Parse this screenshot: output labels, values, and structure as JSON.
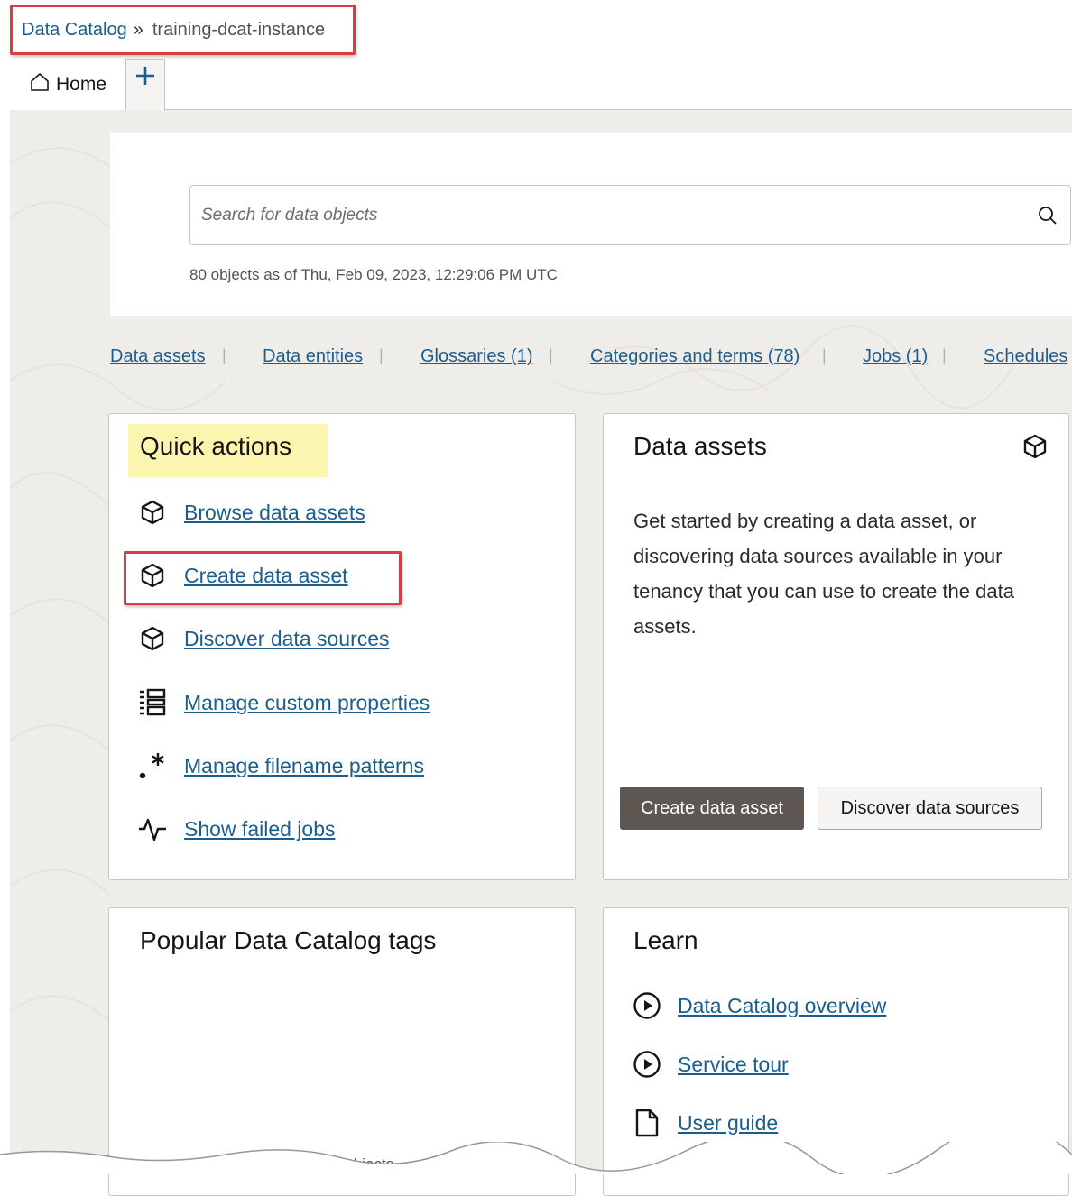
{
  "breadcrumb": {
    "root": "Data Catalog",
    "separator": "»",
    "current": "training-dcat-instance"
  },
  "tabs": {
    "home_label": "Home",
    "add_label": "+"
  },
  "search": {
    "placeholder": "Search for data objects",
    "status": "80 objects as of Thu, Feb 09, 2023, 12:29:06 PM UTC"
  },
  "nav_links": [
    "Data assets",
    "Data entities",
    "Glossaries (1)",
    "Categories and terms (78)",
    "Jobs (1)",
    "Schedules"
  ],
  "quick_actions": {
    "title": "Quick actions",
    "items": [
      {
        "label": "Browse data assets",
        "icon": "cube-icon"
      },
      {
        "label": "Create data asset",
        "icon": "cube-icon"
      },
      {
        "label": "Discover data sources",
        "icon": "cube-icon"
      },
      {
        "label": "Manage custom properties",
        "icon": "list-icon"
      },
      {
        "label": "Manage filename patterns",
        "icon": "regex-icon"
      },
      {
        "label": "Show failed jobs",
        "icon": "activity-icon"
      }
    ]
  },
  "data_assets": {
    "title": "Data assets",
    "description": "Get started by creating a data asset, or discovering data sources available in your tenancy that you can use to create the data assets.",
    "primary_button": "Create data asset",
    "secondary_button": "Discover data sources"
  },
  "tags": {
    "title": "Popular Data Catalog tags",
    "empty_message": "No tags exist for data objects."
  },
  "learn": {
    "title": "Learn",
    "items": [
      {
        "label": "Data Catalog overview",
        "icon": "play-circle-icon"
      },
      {
        "label": "Service tour",
        "icon": "play-circle-icon"
      },
      {
        "label": "User guide",
        "icon": "document-icon"
      }
    ]
  },
  "colors": {
    "link": "#1b5d8c",
    "highlight_border": "#e0393e",
    "title_highlight": "#faf6b0",
    "primary_button": "#5e5651"
  }
}
